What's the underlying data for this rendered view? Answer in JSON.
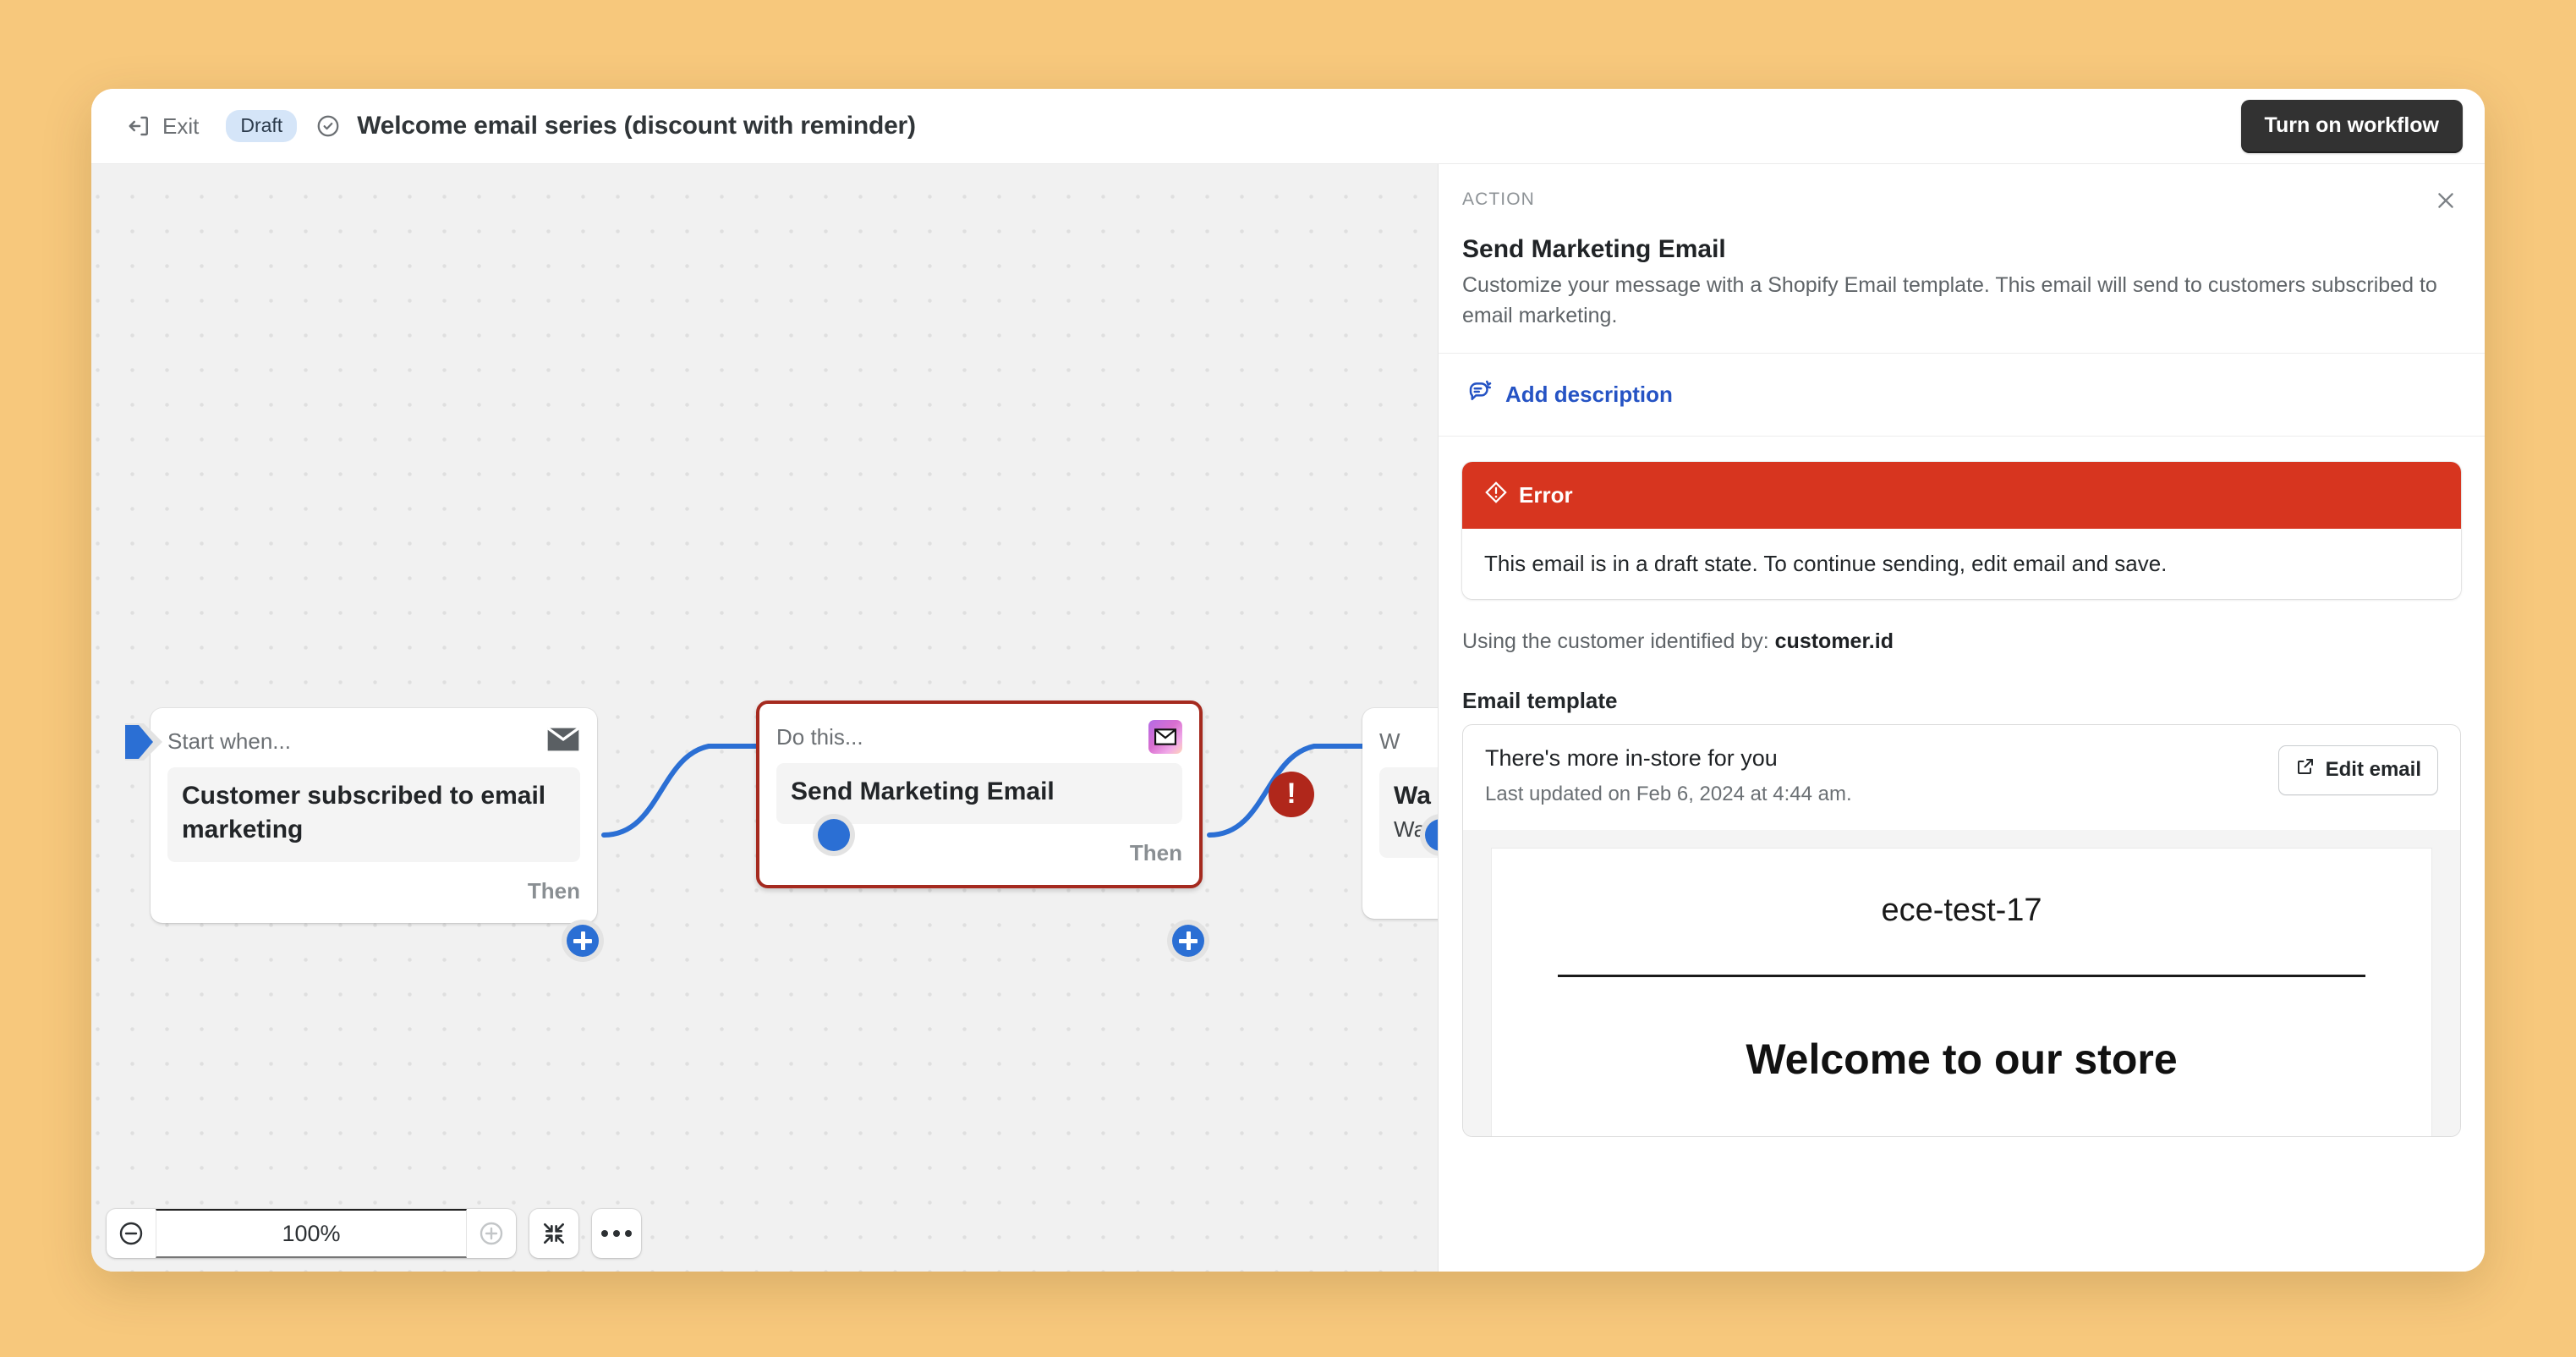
{
  "topbar": {
    "exit_label": "Exit",
    "status_badge": "Draft",
    "workflow_title": "Welcome email series (discount with reminder)",
    "primary_action": "Turn on workflow"
  },
  "canvas": {
    "nodes": [
      {
        "kind": "trigger",
        "header": "Start when...",
        "title": "Customer subscribed to email marketing",
        "subtitle": "",
        "footer": "Then",
        "icon": "envelope-icon"
      },
      {
        "kind": "action",
        "header": "Do this...",
        "title": "Send Marketing Email",
        "subtitle": "",
        "footer": "Then",
        "icon": "shopify-email-icon",
        "badge": "!"
      },
      {
        "kind": "wait",
        "header": "W",
        "title": "Wa",
        "subtitle": "Wai",
        "footer": "",
        "icon": ""
      }
    ],
    "zoom": {
      "zoom_out_label": "−",
      "level": "100%",
      "zoom_in_label": "+",
      "fit_label": "fit-to-screen",
      "more_label": "more-options"
    }
  },
  "panel": {
    "kicker": "ACTION",
    "close_label": "×",
    "title": "Send Marketing Email",
    "description": "Customize your message with a Shopify Email template. This email will send to customers subscribed to email marketing.",
    "add_description_label": "Add description",
    "banner": {
      "heading": "Error",
      "body": "This email is in a draft state. To continue sending, edit email and save."
    },
    "customer_prefix": "Using the customer identified by: ",
    "customer_value": "customer.id",
    "field_label": "Email template",
    "template": {
      "name": "There's more in-store for you",
      "updated": "Last updated on Feb 6, 2024 at 4:44 am.",
      "edit_button": "Edit email",
      "preview_brand": "ece-test-17",
      "preview_heading": "Welcome to our store"
    }
  },
  "colors": {
    "page_background": "#f7c87c",
    "accent_blue": "#2b6fd4",
    "link_blue": "#2553c4",
    "error_red": "#d7351f",
    "node_selected_border": "#a52a1f",
    "badge_bg": "#d5e5f8"
  }
}
